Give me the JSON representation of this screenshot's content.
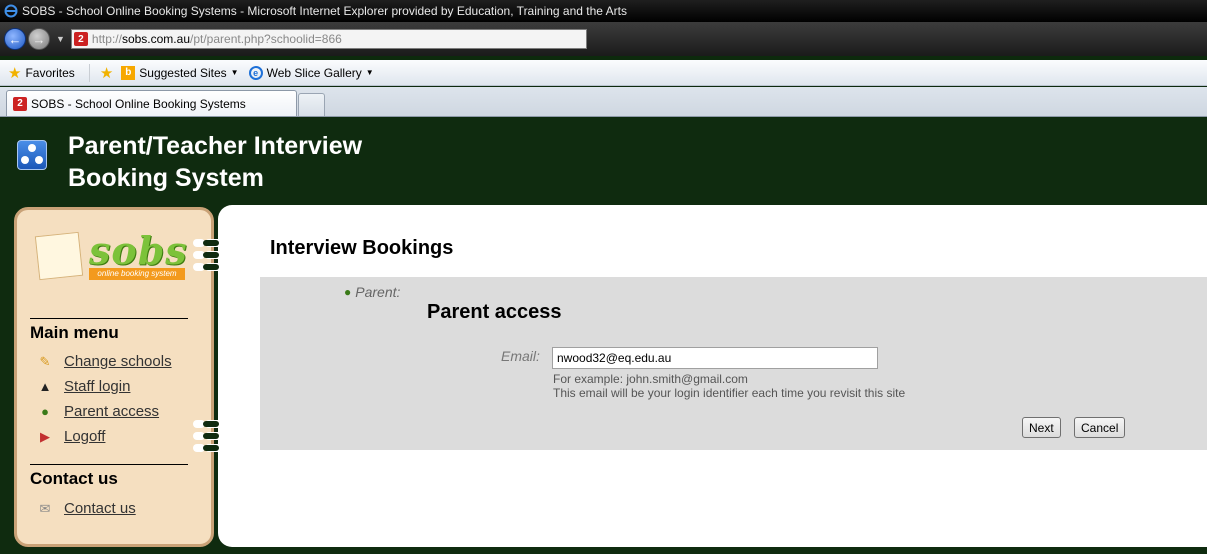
{
  "window": {
    "title": "SOBS - School Online Booking Systems - Microsoft Internet Explorer provided by Education, Training and the Arts"
  },
  "address": {
    "scheme": "http://",
    "host": "sobs.com.au",
    "path": "/pt/parent.php?schoolid=866"
  },
  "favorites_bar": {
    "favorites_label": "Favorites",
    "suggested_label": "Suggested Sites",
    "webslice_label": "Web Slice Gallery"
  },
  "tabs": [
    {
      "label": "SOBS - School Online Booking Systems"
    }
  ],
  "header": {
    "title_line1": "Parent/Teacher Interview",
    "title_line2": "Booking System"
  },
  "sidebar": {
    "logo_text": "sobs",
    "logo_tagline": "online booking system",
    "main_menu_heading": "Main menu",
    "items": [
      {
        "label": "Change schools",
        "icon": "pencil-icon"
      },
      {
        "label": "Staff login",
        "icon": "graduation-cap-icon"
      },
      {
        "label": "Parent access",
        "icon": "person-icon"
      },
      {
        "label": "Logoff",
        "icon": "logoff-icon"
      }
    ],
    "contact_heading": "Contact us",
    "contact_items": [
      {
        "label": "Contact us",
        "icon": "envelope-icon"
      }
    ]
  },
  "main": {
    "section_title": "Interview Bookings",
    "role_label": "Parent:",
    "panel_title": "Parent access",
    "email_label": "Email:",
    "email_value": "nwood32@eq.edu.au",
    "hint_example": "For example: john.smith@gmail.com",
    "hint_identifier": "This email will be your login identifier each time you revisit this site",
    "next_label": "Next",
    "cancel_label": "Cancel"
  },
  "colors": {
    "page_background": "#0f2b0f",
    "sidebar_background": "#f5dfc0",
    "panel_background": "#dcdcdc"
  }
}
